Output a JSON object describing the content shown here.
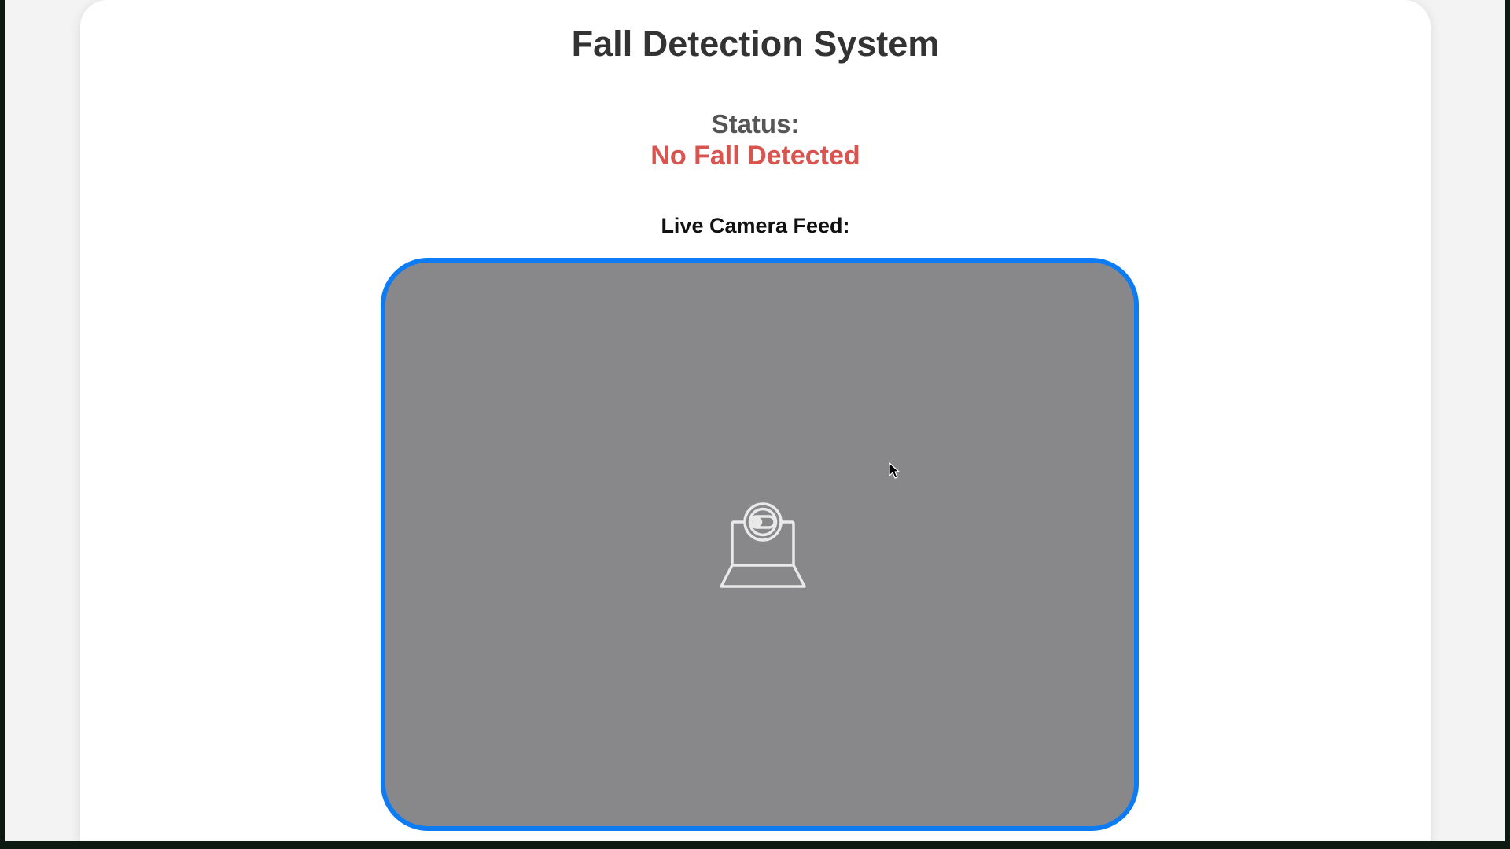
{
  "page": {
    "title": "Fall Detection System"
  },
  "status": {
    "label": "Status:",
    "value": "No Fall Detected",
    "value_color": "#d9534f"
  },
  "feed": {
    "label": "Live Camera Feed:",
    "placeholder_icon": "webcam-icon",
    "border_color": "#0d7bf4",
    "background_color": "#88888a"
  }
}
